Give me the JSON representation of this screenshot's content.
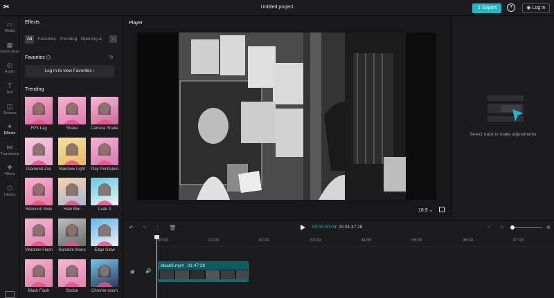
{
  "app": {
    "logo": "✂",
    "project_title": "Untitled project",
    "export_label": "Export",
    "help_label": "?",
    "login_label": "Log in"
  },
  "rail": [
    {
      "icon": "media-icon",
      "glyph": "▭",
      "label": "Media"
    },
    {
      "icon": "stock-videos-icon",
      "glyph": "▦",
      "label": "Stock videos"
    },
    {
      "icon": "audio-icon",
      "glyph": "◴",
      "label": "Audio"
    },
    {
      "icon": "text-icon",
      "glyph": "T",
      "label": "Text"
    },
    {
      "icon": "stickers-icon",
      "glyph": "◫",
      "label": "Stickers"
    },
    {
      "icon": "effects-icon",
      "glyph": "✧",
      "label": "Effects",
      "active": true
    },
    {
      "icon": "transitions-icon",
      "glyph": "⋈",
      "label": "Transitions"
    },
    {
      "icon": "filters-icon",
      "glyph": "❖",
      "label": "Filters"
    },
    {
      "icon": "library-icon",
      "glyph": "⬡",
      "label": "Library"
    }
  ],
  "effects_panel": {
    "title": "Effects",
    "tabs": [
      "All",
      "Favorites",
      "Trending",
      "Opening &"
    ],
    "active_tab": "All",
    "favorites_label": "Favorites",
    "favorites_login": "Log in to view Favorites",
    "trending_label": "Trending",
    "items": [
      {
        "label": "FPS Lag"
      },
      {
        "label": "Shake"
      },
      {
        "label": "Camera Shake"
      },
      {
        "label": "Diamond Zoo"
      },
      {
        "label": "Rainbow Light"
      },
      {
        "label": "Play Pendulum"
      },
      {
        "label": "Rebound Swin"
      },
      {
        "label": "Halo Blur"
      },
      {
        "label": "Leak II"
      },
      {
        "label": "Vibration Flash"
      },
      {
        "label": "Random Mono"
      },
      {
        "label": "Edge Glow"
      },
      {
        "label": "Black Flash"
      },
      {
        "label": "Strobe"
      },
      {
        "label": "Chrome-zoom"
      }
    ]
  },
  "player": {
    "title": "Player",
    "aspect_ratio": "16:9",
    "fullscreen_icon": "fullscreen-icon"
  },
  "inspector": {
    "empty_text": "Select track to make adjustments"
  },
  "timeline": {
    "current_time": "00:00:00:00",
    "separator": "/",
    "total_time": "00:01:47:28",
    "ruler_ticks": [
      "00:00",
      "01:00",
      "02:00",
      "03:00",
      "04:00",
      "05:00",
      "06:00",
      "07:00"
    ],
    "clip": {
      "name": "black9.mp4",
      "duration": "01:47:28"
    }
  },
  "colors": {
    "accent": "#21b7c6",
    "background": "#18181b",
    "panel": "#1c1c1f"
  }
}
